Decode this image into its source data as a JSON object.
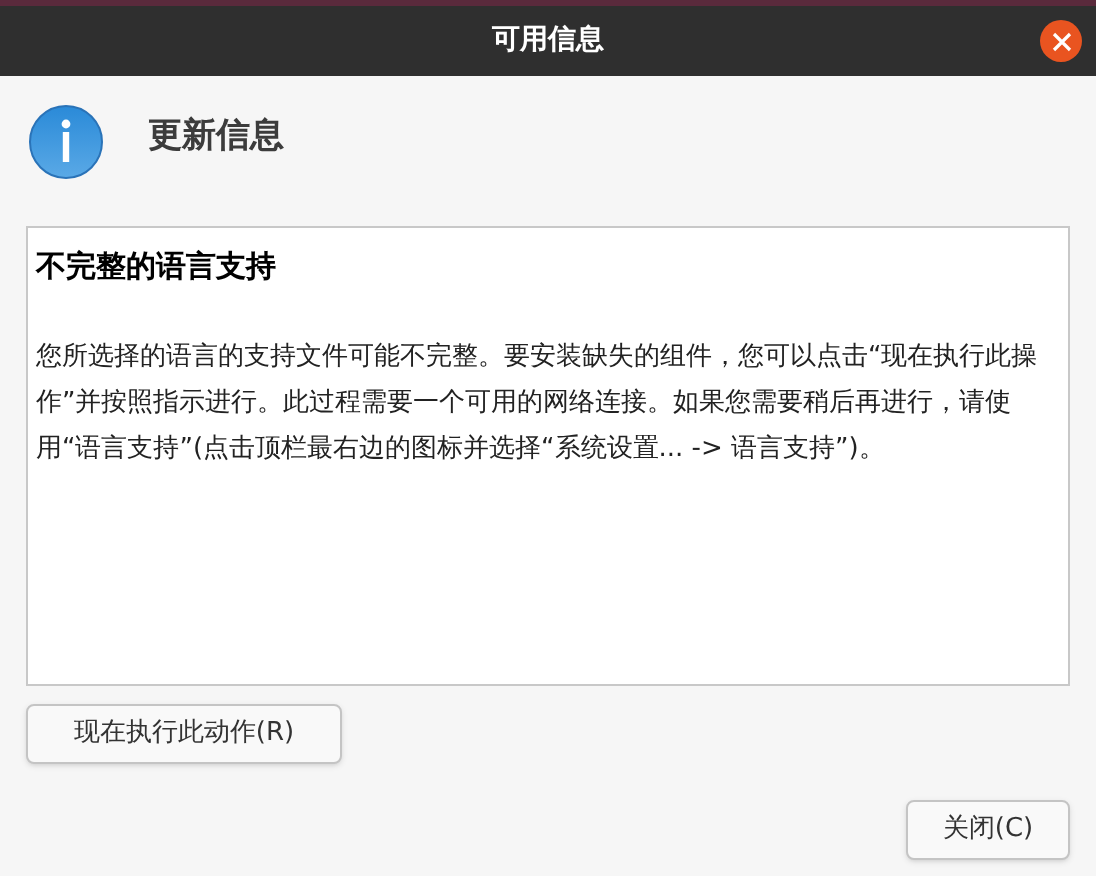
{
  "window": {
    "title": "可用信息"
  },
  "header": {
    "title": "更新信息"
  },
  "message": {
    "heading": "不完整的语言支持",
    "body": "您所选择的语言的支持文件可能不完整。要安装缺失的组件，您可以点击“现在执行此操作”并按照指示进行。此过程需要一个可用的网络连接。如果您需要稍后再进行，请使用“语言支持”(点击顶栏最右边的图标并选择“系统设置... -> 语言支持”)。"
  },
  "buttons": [
    {
      "label": "现在执行此动作(R)",
      "kind": "action"
    },
    {
      "label": "关闭(C)",
      "kind": "close"
    }
  ]
}
